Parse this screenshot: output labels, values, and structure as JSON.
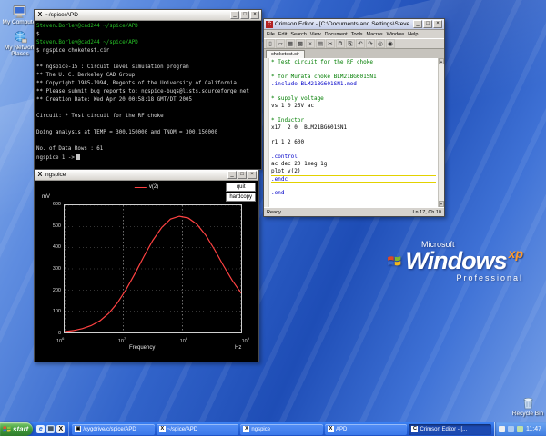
{
  "window_controls": {
    "minimize": "_",
    "maximize": "□",
    "close": "×"
  },
  "icons": {
    "x_logo": "X"
  },
  "desktop": {
    "icons": [
      {
        "name": "my-computer",
        "label": "My Computer"
      },
      {
        "name": "my-network-places",
        "label": "My Network Places"
      }
    ],
    "recycle_bin_label": "Recycle Bin",
    "logo": {
      "brand": "Microsoft",
      "product": "Windows",
      "xp": "xp",
      "edition": "Professional"
    }
  },
  "terminal_window": {
    "title": "~/spice/APD",
    "lines": [
      {
        "cls": "green",
        "text": "Steven.Borley@cad244 ~/spice/APD"
      },
      {
        "cls": "",
        "text": "$"
      },
      {
        "cls": "green",
        "text": "Steven.Borley@cad244 ~/spice/APD"
      },
      {
        "cls": "",
        "text": "$ ngspice choketest.cir"
      },
      {
        "cls": "",
        "text": ""
      },
      {
        "cls": "",
        "text": "** ngspice-15 : Circuit level simulation program"
      },
      {
        "cls": "",
        "text": "** The U. C. Berkeley CAD Group"
      },
      {
        "cls": "",
        "text": "** Copyright 1985-1994, Regents of the University of California."
      },
      {
        "cls": "",
        "text": "** Please submit bug reports to: ngspice-bugs@lists.sourceforge.net"
      },
      {
        "cls": "",
        "text": "** Creation Date: Wed Apr 20 00:58:18 GMT/DT 2005"
      },
      {
        "cls": "",
        "text": ""
      },
      {
        "cls": "",
        "text": "Circuit: * Test circuit for the RF choke"
      },
      {
        "cls": "",
        "text": ""
      },
      {
        "cls": "",
        "text": "Doing analysis at TEMP = 300.150000 and TNOM = 300.150000"
      },
      {
        "cls": "",
        "text": ""
      },
      {
        "cls": "",
        "text": "No. of Data Rows : 61"
      },
      {
        "cls": "cursor",
        "text": "ngspice 1 ->"
      }
    ]
  },
  "plot_window": {
    "title": "ngspice",
    "buttons": [
      {
        "name": "quit-button",
        "label": "quit"
      },
      {
        "name": "hardcopy-button",
        "label": "hardcopy"
      }
    ]
  },
  "chart_data": {
    "type": "line",
    "title": "",
    "ylabel": "mV",
    "xlabel": "Frequency",
    "x_unit": "Hz",
    "legend": [
      {
        "name": "v(2)",
        "color": "#ff4242"
      }
    ],
    "xlim_log10": [
      6,
      9
    ],
    "ylim": [
      0,
      600
    ],
    "yticks": [
      600,
      500,
      400,
      300,
      200,
      100,
      0
    ],
    "xticks": [
      {
        "base": "10",
        "exp": "6"
      },
      {
        "base": "10",
        "exp": "7"
      },
      {
        "base": "10",
        "exp": "8"
      },
      {
        "base": "10",
        "exp": "9"
      }
    ],
    "grid": "dashed",
    "series": [
      {
        "name": "v(2)",
        "color": "#ff4242",
        "x_log10_hz": [
          6.0,
          6.15,
          6.3,
          6.45,
          6.6,
          6.75,
          6.9,
          7.05,
          7.2,
          7.35,
          7.5,
          7.65,
          7.8,
          7.95,
          8.1,
          8.25,
          8.4,
          8.55,
          8.7,
          8.85,
          9.0
        ],
        "values_mV": [
          4,
          9,
          18,
          32,
          55,
          90,
          140,
          205,
          280,
          360,
          435,
          495,
          535,
          548,
          540,
          510,
          458,
          390,
          315,
          245,
          185
        ]
      }
    ]
  },
  "editor_window": {
    "title": "Crimson Editor - [C:\\Documents and Settings\\Steve...",
    "menus": [
      "File",
      "Edit",
      "Search",
      "View",
      "Document",
      "Tools",
      "Macros",
      "Window",
      "Help"
    ],
    "toolbar": [
      {
        "name": "new-icon",
        "glyph": "▯"
      },
      {
        "name": "open-icon",
        "glyph": "▱"
      },
      {
        "name": "save-icon",
        "glyph": "▦"
      },
      {
        "name": "save-all-icon",
        "glyph": "▩"
      },
      {
        "name": "close-file-icon",
        "glyph": "×"
      },
      {
        "name": "print-icon",
        "glyph": "▤"
      },
      {
        "name": "cut-icon",
        "glyph": "✂"
      },
      {
        "name": "copy-icon",
        "glyph": "⧉"
      },
      {
        "name": "paste-icon",
        "glyph": "⎘"
      },
      {
        "name": "undo-icon",
        "glyph": "↶"
      },
      {
        "name": "redo-icon",
        "glyph": "↷"
      },
      {
        "name": "find-icon",
        "glyph": "◎"
      },
      {
        "name": "find-next-icon",
        "glyph": "◉"
      }
    ],
    "tab": "choketest.cir",
    "lines": [
      {
        "cls": "cmt",
        "text": "* Test circuit for the RF choke"
      },
      {
        "cls": "",
        "text": ""
      },
      {
        "cls": "cmt",
        "text": "* for Murata choke BLM21BG601SN1"
      },
      {
        "cls": "dir",
        "text": ".include BLM21BG601SN1.mod"
      },
      {
        "cls": "",
        "text": ""
      },
      {
        "cls": "cmt",
        "text": "* supply voltage"
      },
      {
        "cls": "",
        "text": "vs 1 0 25V ac"
      },
      {
        "cls": "",
        "text": ""
      },
      {
        "cls": "cmt",
        "text": "* Inductor"
      },
      {
        "cls": "",
        "text": "x17  2 0  BLM21BG601SN1"
      },
      {
        "cls": "",
        "text": ""
      },
      {
        "cls": "",
        "text": "r1 1 2 600"
      },
      {
        "cls": "",
        "text": ""
      },
      {
        "cls": "dir",
        "text": ".control"
      },
      {
        "cls": "",
        "text": "ac dec 20 1meg 1g"
      },
      {
        "cls": "",
        "text": "plot v(2)"
      },
      {
        "cls": "dir current",
        "text": ".endc"
      },
      {
        "cls": "",
        "text": ""
      },
      {
        "cls": "dir",
        "text": ".end"
      }
    ],
    "status_left": "Ready",
    "status_right": "Ln 17, Ch 10"
  },
  "taskbar": {
    "start_label": "start",
    "quick_launch": [
      {
        "name": "internet-explorer-icon",
        "glyph": "e"
      },
      {
        "name": "show-desktop-icon",
        "glyph": "▦"
      },
      {
        "name": "x-server-icon",
        "glyph": "X"
      }
    ],
    "buttons": [
      {
        "icon": "▣",
        "label": "/cygdrive/c/spice/APD",
        "pressed": false
      },
      {
        "icon": "X",
        "label": "~/spice/APD",
        "pressed": false
      },
      {
        "icon": "X",
        "label": "ngspice",
        "pressed": false
      },
      {
        "icon": "X",
        "label": "APD",
        "pressed": false
      },
      {
        "icon": "C",
        "label": "Crimson Editor - [...",
        "pressed": true
      }
    ],
    "tray_icons": [
      {
        "name": "x-server-icon"
      },
      {
        "name": "volume-icon"
      },
      {
        "name": "network-icon"
      }
    ],
    "clock": "11:47"
  }
}
